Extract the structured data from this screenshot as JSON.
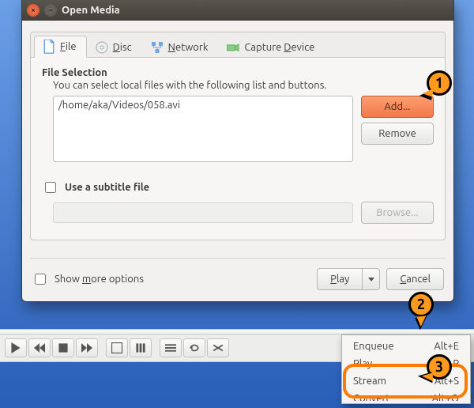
{
  "window": {
    "title": "Open Media",
    "close": "×",
    "min": "–"
  },
  "tabs": {
    "file": "File",
    "disc": "Disc",
    "network": "Network",
    "capture": "Capture Device"
  },
  "file_section": {
    "title": "File Selection",
    "desc": "You can select local files with the following list and buttons.",
    "files": [
      "/home/aka/Videos/058.avi"
    ],
    "add": "Add...",
    "remove": "Remove"
  },
  "subtitle": {
    "label": "Use a subtitle file",
    "browse": "Browse..."
  },
  "footer": {
    "show_more": "Show more options",
    "play": "Play",
    "cancel": "Cancel"
  },
  "menu": {
    "items": [
      {
        "label": "Enqueue",
        "accel": "Alt+E"
      },
      {
        "label": "Play",
        "accel": "Alt+P"
      },
      {
        "label": "Stream",
        "accel": "Alt+S"
      },
      {
        "label": "Convert",
        "accel": "Alt+O"
      }
    ]
  },
  "callouts": {
    "c1": "1",
    "c2": "2",
    "c3": "3"
  },
  "toolbar": {
    "time": "--:--"
  },
  "underline": {
    "F": "F",
    "D": "D",
    "N": "N",
    "Cap_D": "D",
    "m": "m",
    "P": "P",
    "C": "C"
  }
}
